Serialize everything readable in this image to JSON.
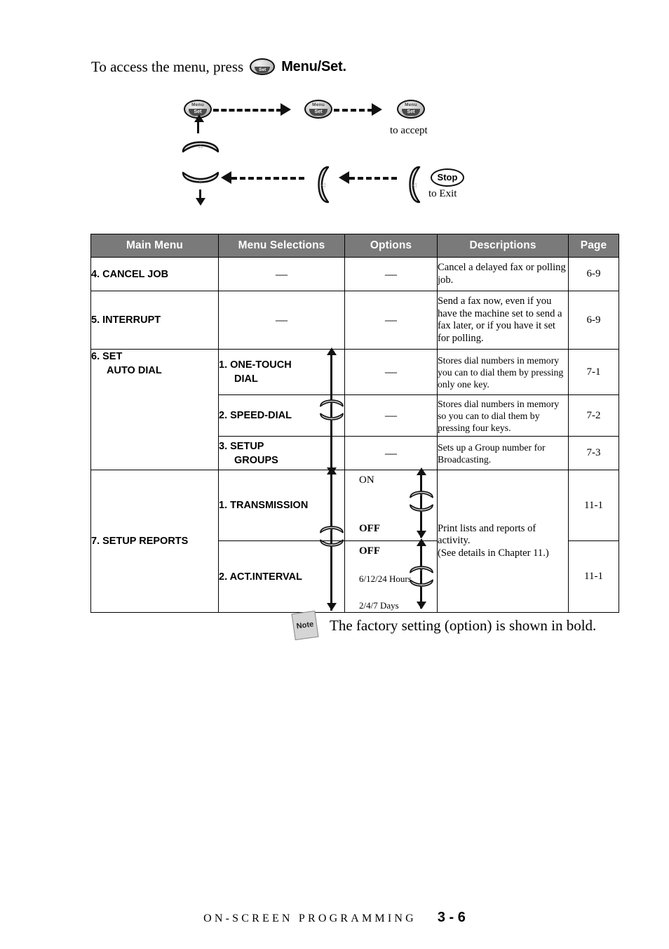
{
  "intro": {
    "text_before": "To access the menu, press",
    "button": {
      "line1": "Menu",
      "line2": "Set"
    },
    "text_after": "Menu/Set."
  },
  "flow": {
    "buttons": [
      {
        "line1": "Menu",
        "line2": "Set"
      },
      {
        "line1": "Menu",
        "line2": "Set"
      },
      {
        "line1": "Menu",
        "line2": "Set"
      }
    ],
    "to_accept": "to accept",
    "stop_label": "Stop",
    "to_exit": "to Exit",
    "key_up_glyph": "△",
    "key_down_glyph": "▽",
    "key_left_glyph": "◁"
  },
  "table": {
    "headers": [
      "Main Menu",
      "Menu Selections",
      "Options",
      "Descriptions",
      "Page"
    ],
    "rows": [
      {
        "main": "4. CANCEL JOB",
        "selection": "—",
        "option": "—",
        "description": "Cancel a delayed fax or polling job.",
        "page": "6-9"
      },
      {
        "main": "5. INTERRUPT",
        "selection": "—",
        "option": "—",
        "description": "Send a fax now, even if you have the machine set to send a fax later, or if you have it set for polling.",
        "page": "6-9"
      },
      {
        "main": "6. SET\nAUTO DIAL",
        "main_l1": "6. SET",
        "main_l2": "AUTO DIAL",
        "selection": "1. ONE-TOUCH",
        "selection_l2": "DIAL",
        "option": "—",
        "description": "Stores dial numbers in memory you can to dial them by pressing only one key.",
        "page": "7-1"
      },
      {
        "selection": "2. SPEED-DIAL",
        "option": "—",
        "description": "Stores dial numbers in memory so you can to dial them by pressing four keys.",
        "page": "7-2"
      },
      {
        "selection": "3. SETUP",
        "selection_l2": "GROUPS",
        "option": "—",
        "description": "Sets up a Group number for Broadcasting.",
        "page": "7-3"
      },
      {
        "main": "7. SETUP REPORTS",
        "selection": "1. TRANSMISSION",
        "options_list": [
          "ON",
          "OFF"
        ],
        "description": "Print lists and reports of activity.\n(See details in Chapter 11.)",
        "description_l1": "Print lists and reports of",
        "description_l2": "activity.",
        "description_l3": "(See details in Chapter 11.)",
        "page": "11-1"
      },
      {
        "selection": "2.  ACT.INTERVAL",
        "options_list": [
          "OFF",
          "6/12/24 Hours",
          "2/4/7 Days"
        ],
        "page": "11-1"
      }
    ]
  },
  "note": {
    "icon_label": "Note",
    "text": "The factory setting (option) is shown in bold."
  },
  "footer": {
    "title": "ON-SCREEN PROGRAMMING",
    "page": "3 - 6"
  }
}
